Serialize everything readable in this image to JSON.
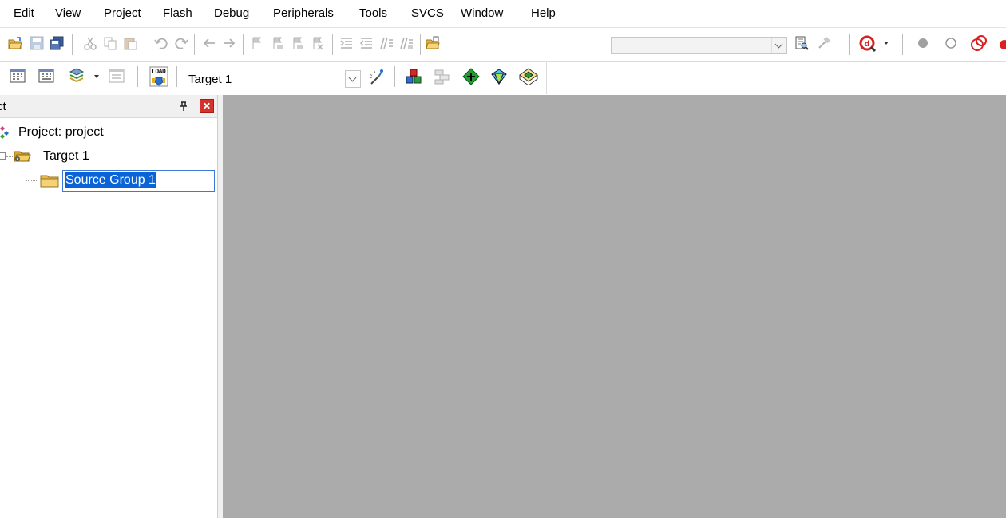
{
  "menu": {
    "items": [
      {
        "label": "Edit"
      },
      {
        "label": "View"
      },
      {
        "label": "Project"
      },
      {
        "label": "Flash"
      },
      {
        "label": "Debug"
      },
      {
        "label": "Peripherals"
      },
      {
        "label": "Tools"
      },
      {
        "label": "SVCS"
      },
      {
        "label": "Window"
      },
      {
        "label": "Help"
      }
    ]
  },
  "toolbar2": {
    "target_select": "Target 1",
    "load_label": "LOAD"
  },
  "project_panel": {
    "title": "ct",
    "root": "Project: project",
    "target": "Target 1",
    "group_edit_value": "Source Group 1"
  },
  "colors": {
    "workspace": "#ababab",
    "selection": "#0a64d8",
    "close_button": "#d7312b",
    "find_icon": "#d92020"
  }
}
